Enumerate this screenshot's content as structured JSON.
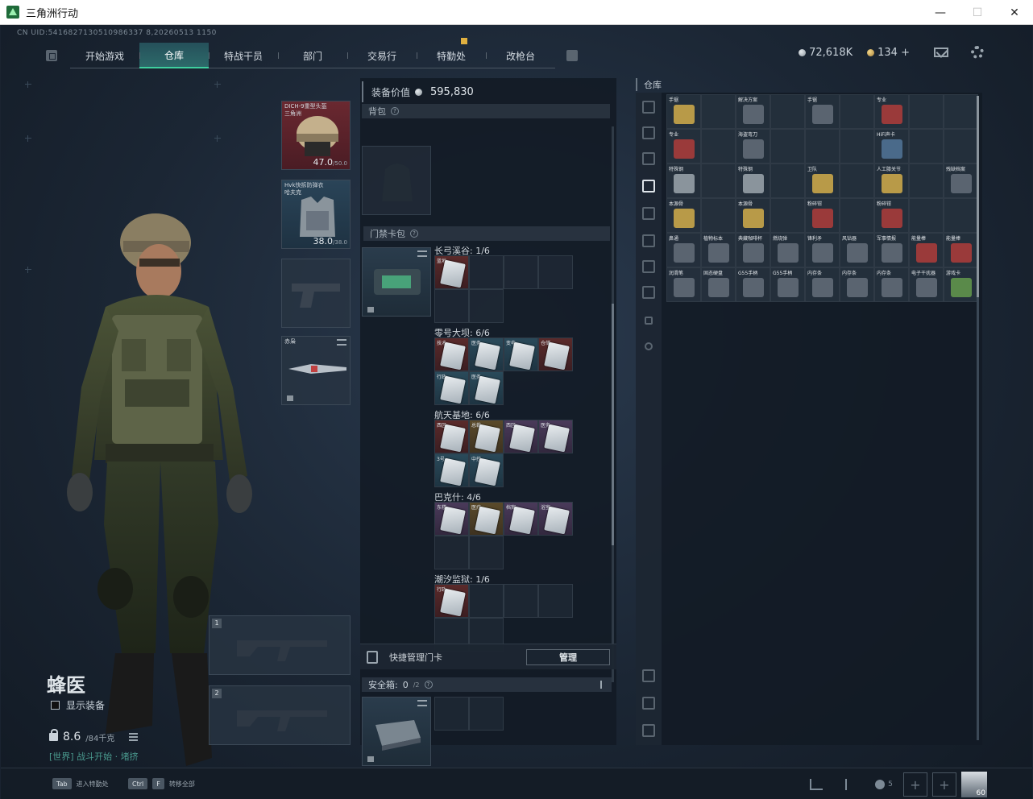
{
  "window": {
    "title": "三角洲行动"
  },
  "uid": "CN UID:5416827130510986337 8,20260513 1150",
  "nav": {
    "tabs": [
      {
        "label": "开始游戏",
        "active": false
      },
      {
        "label": "仓库",
        "active": true
      },
      {
        "label": "特战干员",
        "active": false
      },
      {
        "label": "部门",
        "active": false
      },
      {
        "label": "交易行",
        "active": false
      },
      {
        "label": "特勤处",
        "active": false,
        "badge": true
      },
      {
        "label": "改枪台",
        "active": false
      }
    ]
  },
  "currency": {
    "silver": "72,618K",
    "gold": "134",
    "plus": "+"
  },
  "character": {
    "name": "蜂医",
    "show_equipment": "显示装备",
    "weight": "8.6",
    "weight_max": "/84千克",
    "status": "[世界] 战斗开始 · 堵挤"
  },
  "equipment": {
    "helmet": {
      "label": "DICH-9重型头盔",
      "label2": "三角洲",
      "durability": "47.0",
      "durability_max": "/50.0"
    },
    "armor": {
      "label": "Hvk快拆防弹衣",
      "label2": "哈夫克",
      "durability": "38.0",
      "durability_max": "/38.0"
    },
    "knife": {
      "label": "赤枭"
    },
    "gun1_num": "1",
    "gun2_num": "2"
  },
  "middle": {
    "equipment_value_label": "装备价值",
    "equipment_value": "595,830",
    "backpack_label": "背包",
    "keycase_label": "门禁卡包",
    "help": "?",
    "groups": [
      {
        "title": "长弓溪谷: 1/6",
        "cells": [
          [
            "red",
            "蓝地"
          ],
          [
            "",
            ""
          ],
          [
            "",
            ""
          ],
          [
            "",
            ""
          ],
          [
            "",
            ""
          ],
          [
            "",
            ""
          ]
        ]
      },
      {
        "title": "零号大坝: 6/6",
        "cells": [
          [
            "red",
            "技术"
          ],
          [
            "blue",
            "医务"
          ],
          [
            "blue",
            "变电"
          ],
          [
            "red",
            "仓储"
          ],
          [
            "blue",
            "行政"
          ],
          [
            "blue",
            "医务"
          ]
        ]
      },
      {
        "title": "航天基地: 6/6",
        "cells": [
          [
            "red",
            "西区"
          ],
          [
            "gold",
            "总裁"
          ],
          [
            "purple",
            "西区"
          ],
          [
            "purple",
            "医务"
          ],
          [
            "blue",
            "3号"
          ],
          [
            "blue",
            "中控"
          ]
        ]
      },
      {
        "title": "巴克什: 4/6",
        "cells": [
          [
            "purple",
            "东楼"
          ],
          [
            "gold",
            "医疗"
          ],
          [
            "purple",
            "档案"
          ],
          [
            "purple",
            "浴室"
          ],
          [
            "",
            ""
          ],
          [
            "",
            ""
          ]
        ]
      },
      {
        "title": "潮汐监狱: 1/6",
        "cells": [
          [
            "red",
            "行政"
          ],
          [
            "",
            ""
          ],
          [
            "",
            ""
          ],
          [
            "",
            ""
          ],
          [
            "",
            ""
          ],
          [
            "",
            ""
          ]
        ]
      }
    ],
    "quick_manage": "快捷管理门卡",
    "manage_button": "管理",
    "safe_box_label": "安全箱:",
    "safe_box_value": "0",
    "safe_box_max": "/2"
  },
  "warehouse": {
    "title": "仓库",
    "items": [
      [
        "手锯",
        "gold"
      ],
      [
        "",
        ""
      ],
      [
        "解决方案",
        "dark"
      ],
      [
        "",
        ""
      ],
      [
        "手锯",
        "dark"
      ],
      [
        "",
        ""
      ],
      [
        "专业",
        "red"
      ],
      [
        "",
        ""
      ],
      [
        "",
        ""
      ],
      [
        "专业",
        "red"
      ],
      [
        "",
        ""
      ],
      [
        "海盗弯刀",
        "dark"
      ],
      [
        "",
        ""
      ],
      [
        "",
        ""
      ],
      [
        "",
        ""
      ],
      [
        "HiFi声卡",
        "blue"
      ],
      [
        "",
        ""
      ],
      [
        "",
        ""
      ],
      [
        "特殊钢",
        "grey"
      ],
      [
        "",
        ""
      ],
      [
        "特殊钢",
        "grey"
      ],
      [
        "",
        ""
      ],
      [
        "卫队",
        "gold"
      ],
      [
        "",
        ""
      ],
      [
        "人工膝关节",
        "gold"
      ],
      [
        "",
        ""
      ],
      [
        "残缺档案",
        "dark"
      ],
      [
        "本源骨",
        "gold"
      ],
      [
        "",
        ""
      ],
      [
        "本源骨",
        "gold"
      ],
      [
        "",
        ""
      ],
      [
        "粉碎钳",
        "red"
      ],
      [
        "",
        ""
      ],
      [
        "粉碎钳",
        "red"
      ],
      [
        "",
        ""
      ],
      [
        "",
        ""
      ],
      [
        "鼻通",
        "dark"
      ],
      [
        "植物标本",
        "dark"
      ],
      [
        "典藏咖啡杯",
        "dark"
      ],
      [
        "燃烧弹",
        "dark"
      ],
      [
        "锋利矛",
        "dark"
      ],
      [
        "风钻器",
        "dark"
      ],
      [
        "军事情报",
        "dark"
      ],
      [
        "能量棒",
        "red"
      ],
      [
        "能量棒",
        "red"
      ],
      [
        "润滑笔",
        "dark"
      ],
      [
        "固态硬盘",
        "dark"
      ],
      [
        "G55手柄",
        "dark"
      ],
      [
        "G55手柄",
        "dark"
      ],
      [
        "内存条",
        "dark"
      ],
      [
        "内存条",
        "dark"
      ],
      [
        "内存条",
        "dark"
      ],
      [
        "电子干扰器",
        "dark"
      ],
      [
        "游戏卡",
        "green"
      ]
    ]
  },
  "bottom": {
    "hint1_key": "Tab",
    "hint1": "进入特勤处",
    "hint2_key": "Ctrl",
    "hint2_key2": "F",
    "hint2": "转移全部",
    "friends": "5",
    "avatar_level": "60"
  }
}
